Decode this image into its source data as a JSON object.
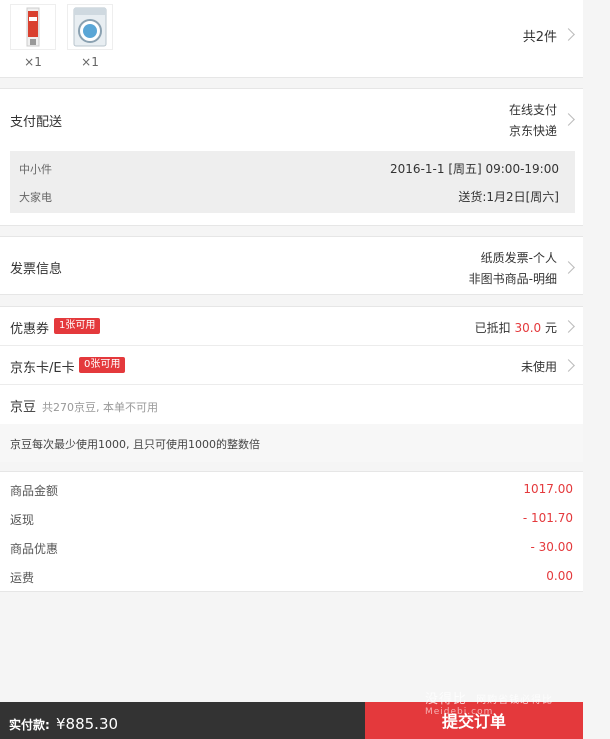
{
  "products": {
    "items": [
      {
        "icon": "toothpaste-product-icon",
        "qty": "×1"
      },
      {
        "icon": "washing-machine-product-icon",
        "qty": "×1"
      }
    ],
    "total": "共2件"
  },
  "delivery": {
    "title": "支付配送",
    "payment": "在线支付",
    "carrier": "京东快递",
    "small_label": "中小件",
    "small_time": "2016-1-1 [周五] 09:00-19:00",
    "large_label": "大家电",
    "large_time": "送货:1月2日[周六]"
  },
  "invoice": {
    "title": "发票信息",
    "type": "纸质发票-个人",
    "detail": "非图书商品-明细"
  },
  "discounts": {
    "coupon_label": "优惠券",
    "coupon_badge": "1张可用",
    "coupon_prefix": "已抵扣",
    "coupon_amount": "30.0",
    "coupon_unit": "元",
    "card_label": "京东卡/E卡",
    "card_badge": "0张可用",
    "card_status": "未使用",
    "bean_label": "京豆",
    "bean_hint": "共270京豆, 本单不可用",
    "bean_note": "京豆每次最少使用1000, 且只可使用1000的整数倍"
  },
  "amounts": [
    {
      "label": "商品金额",
      "value": "1017.00"
    },
    {
      "label": "返现",
      "value": "- 101.70"
    },
    {
      "label": "商品优惠",
      "value": "- 30.00"
    },
    {
      "label": "运费",
      "value": "0.00"
    }
  ],
  "bottom": {
    "pay_label": "实付款:",
    "pay_amount": "¥885.30",
    "submit": "提交订单"
  },
  "watermark": {
    "logo": "没得比",
    "url": "Meidebi.com",
    "slogan": "网购省钱必得比"
  },
  "colors": {
    "accent": "#e4393c",
    "bar": "#333333"
  }
}
